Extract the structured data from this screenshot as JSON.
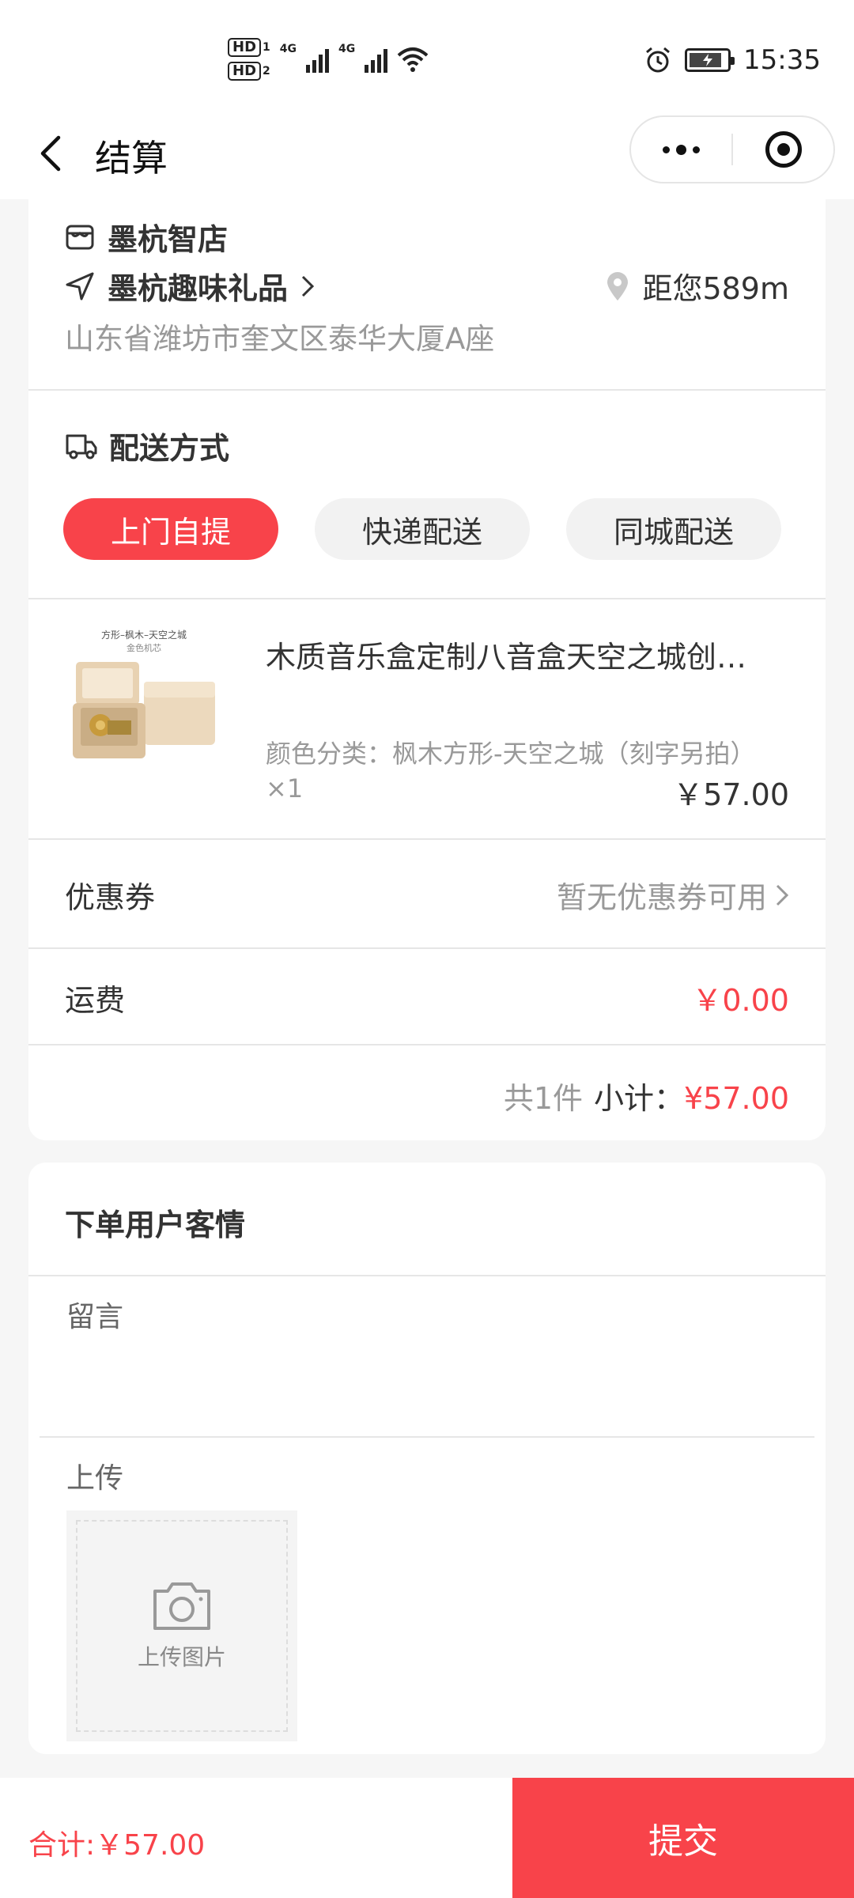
{
  "status_bar": {
    "hd1": "HD",
    "hd1_sub": "1",
    "hd2": "HD",
    "hd2_sub": "2",
    "net1": "4G",
    "net2": "4G",
    "time": "15:35"
  },
  "nav": {
    "title": "结算",
    "back_icon": "chevron-left-icon",
    "more_icon": "more-dots-icon",
    "close_icon": "target-circle-icon"
  },
  "store": {
    "brand": "墨杭智店",
    "name": "墨杭趣味礼品",
    "distance": "距您589m",
    "address": "山东省潍坊市奎文区泰华大厦A座"
  },
  "delivery": {
    "title": "配送方式",
    "options": [
      "上门自提",
      "快递配送",
      "同城配送"
    ],
    "selected_index": 0
  },
  "product": {
    "image_caption_line1": "方形–枫木–天空之城",
    "image_caption_line2": "金色机芯",
    "title": "木质音乐盒定制八音盒天空之城创…",
    "spec": "颜色分类：枫木方形-天空之城（刻字另拍）",
    "qty": "×1",
    "price": "￥57.00"
  },
  "coupon": {
    "label": "优惠券",
    "value": "暂无优惠券可用"
  },
  "shipping": {
    "label": "运费",
    "value": "￥0.00"
  },
  "subtotal": {
    "count": "共1件",
    "label": "小计：",
    "amount": "¥57.00"
  },
  "customer_info": {
    "title": "下单用户客情",
    "message_label": "留言",
    "message_value": "",
    "upload_label": "上传",
    "upload_button": "上传图片"
  },
  "footer": {
    "total": "合计:￥57.00",
    "submit": "提交"
  },
  "colors": {
    "accent": "#f8434a",
    "muted": "#999999",
    "text": "#333333"
  }
}
